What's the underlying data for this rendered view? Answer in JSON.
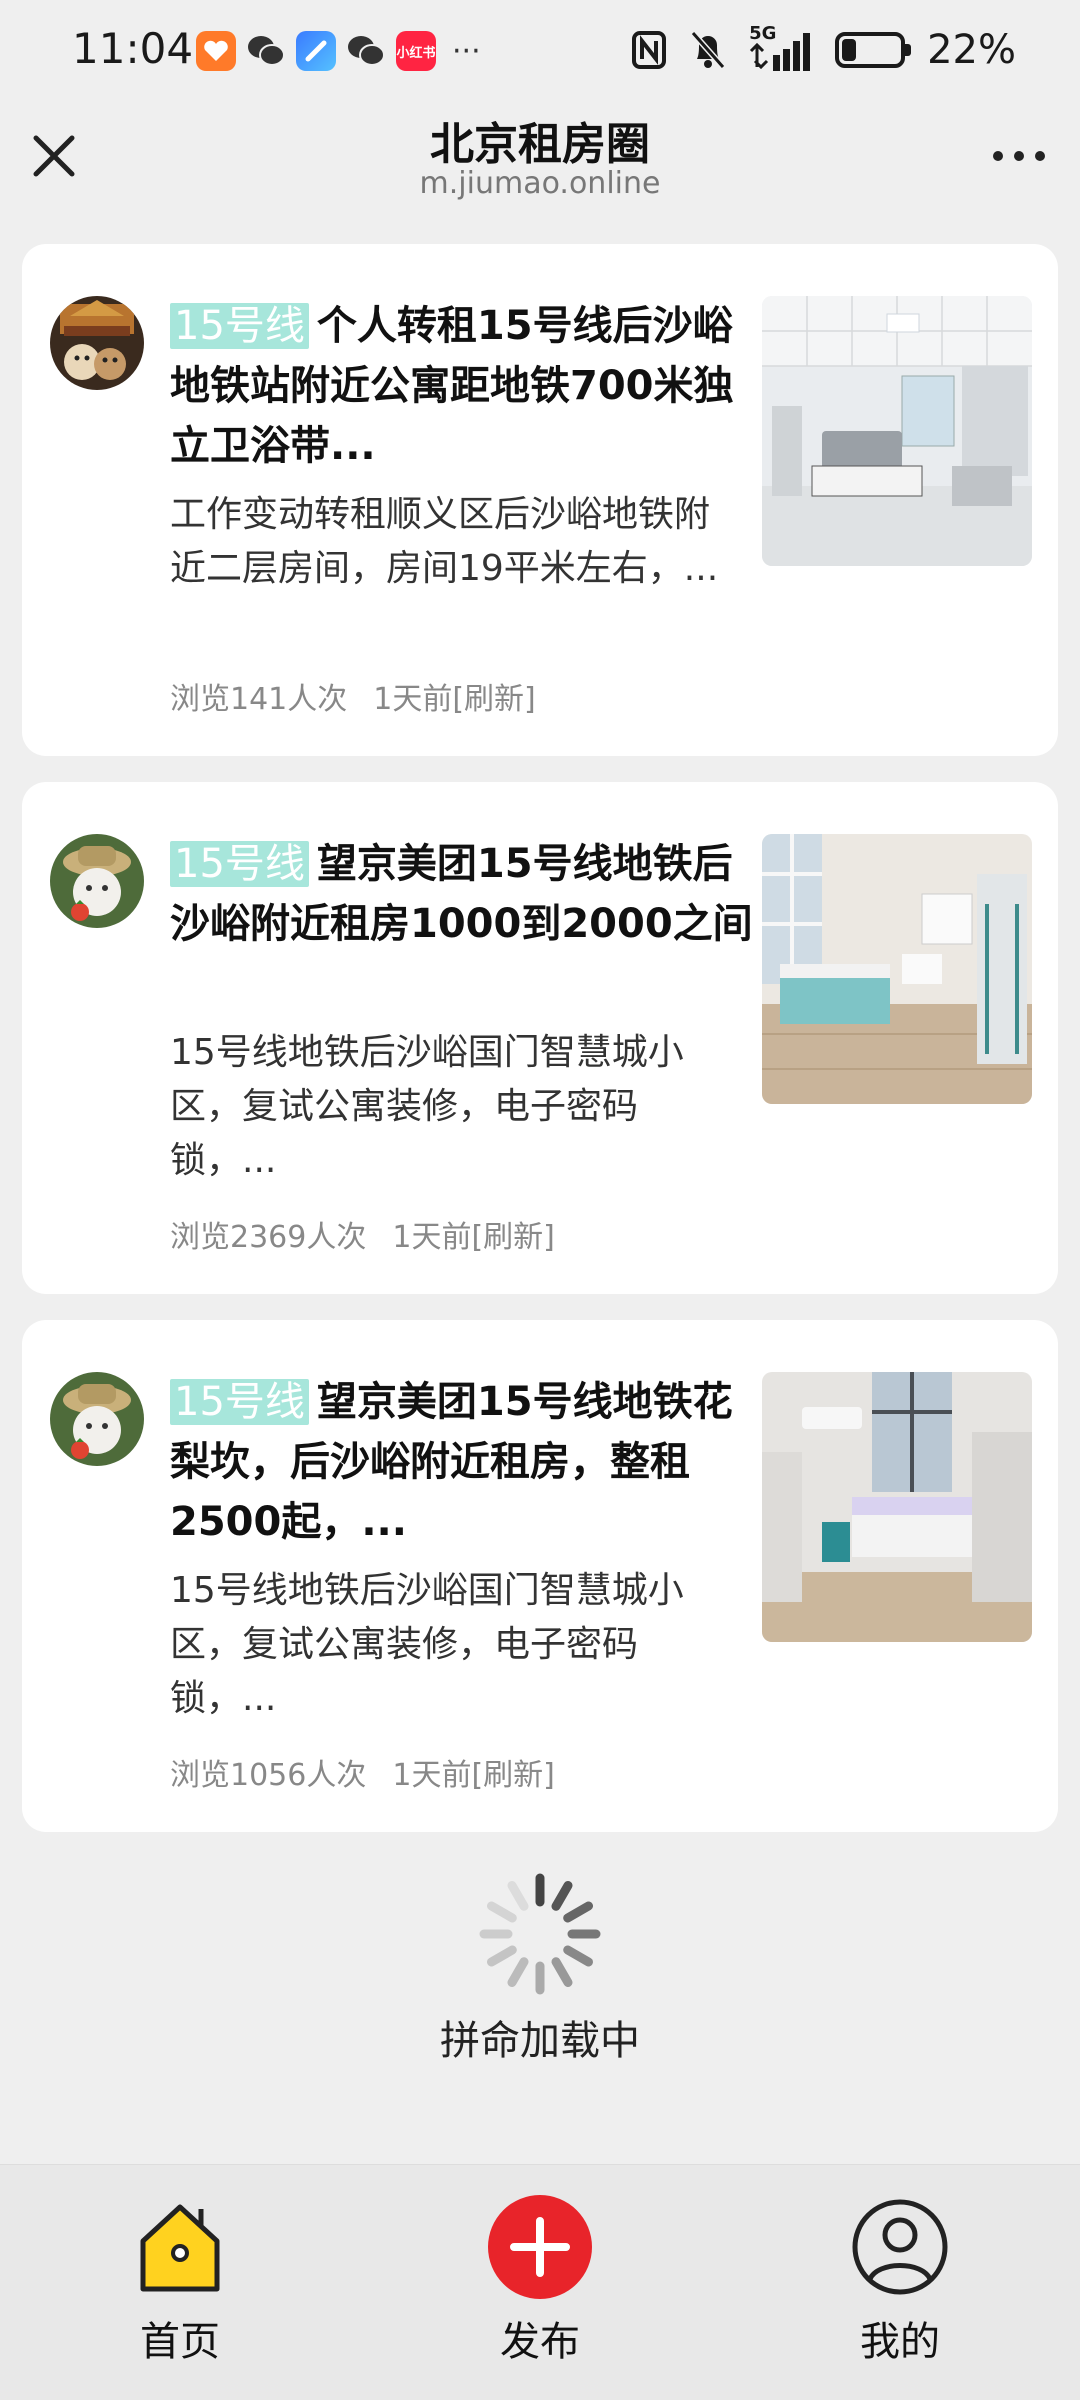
{
  "status_bar": {
    "time": "11:04",
    "battery_percent": "22%",
    "battery_level": 0.22,
    "network": "5G",
    "app_icons": [
      "taobao-icon",
      "wechat-icon",
      "browser-icon",
      "wechat-icon",
      "xiaohongshu-icon"
    ],
    "xiaohongshu_label": "小红书",
    "more": "···"
  },
  "header": {
    "title": "北京租房圈",
    "subtitle": "m.jiumao.online"
  },
  "listings": [
    {
      "tag": "15号线",
      "title": "个人转租15号线后沙峪地铁站附近公寓距地铁700米独立卫浴带...",
      "description": "工作变动转租顺义区后沙峪地铁附近二层房间，房间19平米左右，...",
      "views": "浏览141人次",
      "time": "1天前[刷新]"
    },
    {
      "tag": "15号线",
      "title": "望京美团15号线地铁后沙峪附近租房1000到2000之间",
      "description": "15号线地铁后沙峪国门智慧城小区，复试公寓装修，电子密码锁，...",
      "views": "浏览2369人次",
      "time": "1天前[刷新]"
    },
    {
      "tag": "15号线",
      "title": "望京美团15号线地铁花梨坎，后沙峪附近租房，整租2500起，...",
      "description": "15号线地铁后沙峪国门智慧城小区，复试公寓装修，电子密码锁，...",
      "views": "浏览1056人次",
      "time": "1天前[刷新]"
    }
  ],
  "loading": {
    "text": "拼命加载中"
  },
  "bottom_nav": {
    "home": "首页",
    "publish": "发布",
    "mine": "我的"
  },
  "colors": {
    "background": "#efefef",
    "tag": "#a7e6db",
    "publish_button": "#e8242a",
    "home_icon_fill": "#ffd21f"
  }
}
